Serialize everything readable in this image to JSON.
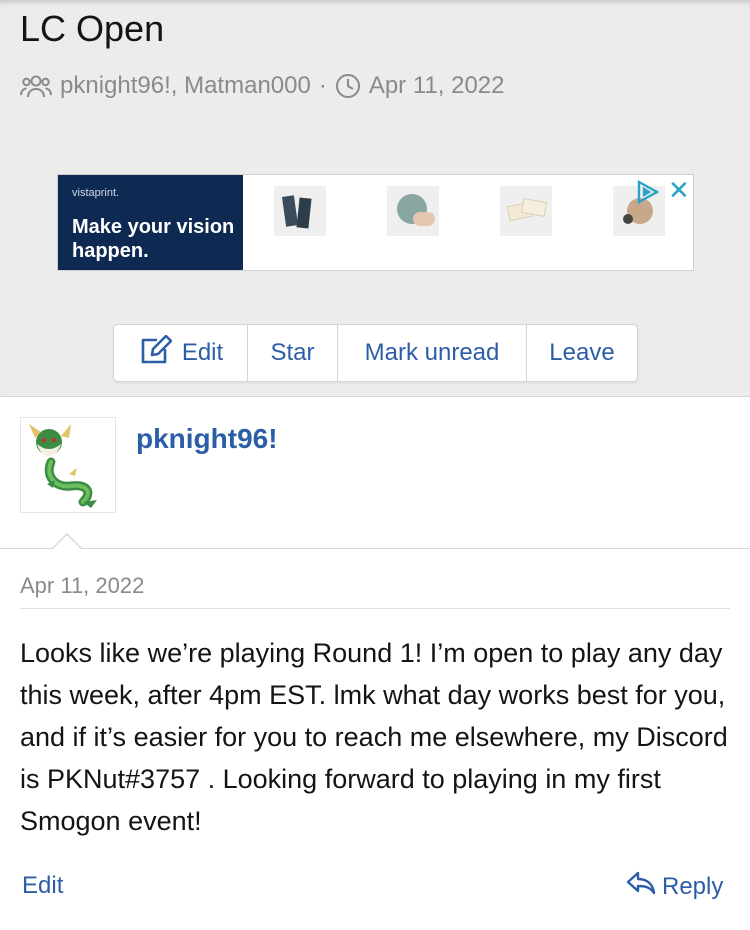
{
  "thread": {
    "title": "LC Open",
    "participants": "pknight96!, Matman000",
    "separator": "·",
    "date": "Apr 11, 2022",
    "icons": {
      "participants": "users-icon",
      "date": "clock-icon"
    }
  },
  "ad": {
    "brand": "vistaprint.",
    "tagline": "Make your vision happen.",
    "choices_icon": "ad-choices-icon",
    "close_label": "✕"
  },
  "toolbar": {
    "edit_label": "Edit",
    "star_label": "Star",
    "mark_unread_label": "Mark unread",
    "leave_label": "Leave",
    "edit_icon": "edit-icon"
  },
  "post": {
    "author": "pknight96!",
    "avatar": "serperior-avatar",
    "date": "Apr 11, 2022",
    "body": "Looks like we’re playing Round 1! I’m open to play any day this week, after 4pm EST. lmk what day works best for you, and if it’s easier for you to reach me elsewhere, my Discord is PKNut#3757 . Looking forward to playing in my first Smogon event!",
    "edit_label": "Edit",
    "reply_label": "Reply",
    "reply_icon": "reply-icon"
  },
  "colors": {
    "link": "#2c5ea8",
    "muted": "#8a8a8a",
    "header_bg": "#ececec",
    "ad_navy": "#0f2a52",
    "ad_accent": "#2aa3c6"
  }
}
